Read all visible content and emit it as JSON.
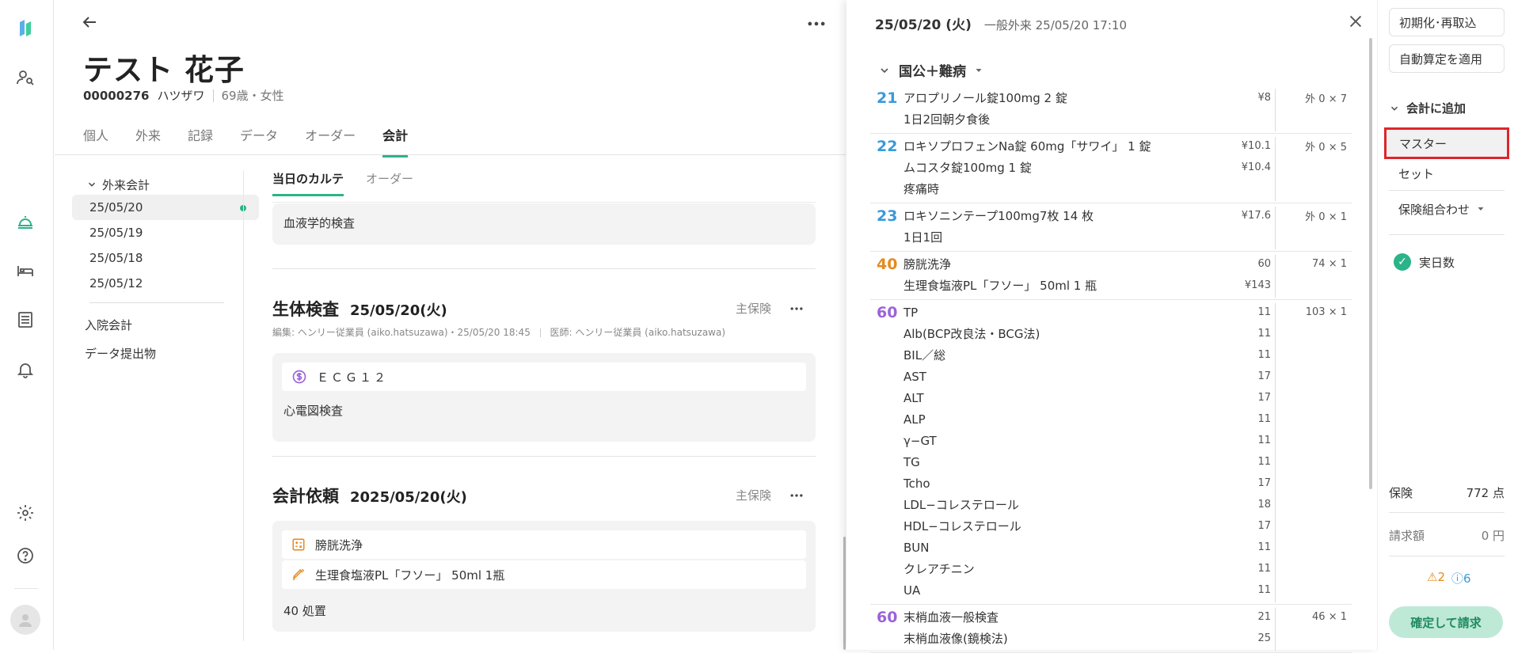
{
  "patient": {
    "name": "テスト 花子",
    "id": "00000276",
    "kana": "ハツザワ",
    "age_sex": "69歳・女性"
  },
  "tabs": [
    "個人",
    "外来",
    "記録",
    "データ",
    "オーダー",
    "会計"
  ],
  "nav": {
    "header": "外来会計",
    "dates": [
      "25/05/20",
      "25/05/19",
      "25/05/18",
      "25/05/12"
    ],
    "links": [
      "入院会計",
      "データ提出物"
    ]
  },
  "content": {
    "tabs": [
      "当日のカルテ",
      "オーダー"
    ],
    "top_card_text": "血液学的検査",
    "section1": {
      "title": "生体検査",
      "date": "25/05/20(火)",
      "meta": "編集: ヘンリー従業員 (aiko.hatsuzawa)・25/05/20 18:45",
      "meta2": "医師: ヘンリー従業員 (aiko.hatsuzawa)",
      "insurance": "主保険",
      "item": "ＥＣＧ１２",
      "note": "心電図検査"
    },
    "section2": {
      "title": "会計依頼",
      "date": "2025/05/20(火)",
      "insurance": "主保険",
      "items": [
        "膀胱洗浄",
        "生理食塩液PL「フソー」 50ml  1瓶"
      ],
      "note": "40 処置"
    }
  },
  "panel": {
    "date": "25/05/20 (火)",
    "visit": "一般外来 25/05/20 17:10",
    "group": "国公＋難病",
    "orders": [
      {
        "no": "21",
        "color": "#3a9ad9",
        "lines": [
          {
            "name": "アロプリノール錠100mg  2 錠",
            "price": "¥8",
            "qty": "外 0 × 7"
          },
          {
            "name": "1日2回朝夕食後",
            "price": "",
            "qty": ""
          }
        ]
      },
      {
        "no": "22",
        "color": "#3a9ad9",
        "lines": [
          {
            "name": "ロキソプロフェンNa錠 60mg「サワイ」  1 錠",
            "price": "¥10.1",
            "qty": "外 0 × 5"
          },
          {
            "name": "ムコスタ錠100mg  1 錠",
            "price": "¥10.4",
            "qty": ""
          },
          {
            "name": "疼痛時",
            "price": "",
            "qty": ""
          }
        ]
      },
      {
        "no": "23",
        "color": "#3a9ad9",
        "lines": [
          {
            "name": "ロキソニンテープ100mg7枚  14 枚",
            "price": "¥17.6",
            "qty": "外 0 × 1"
          },
          {
            "name": "1日1回",
            "price": "",
            "qty": ""
          }
        ]
      },
      {
        "no": "40",
        "color": "#e58a1f",
        "lines": [
          {
            "name": "膀胱洗浄",
            "price": "60",
            "qty": "74 × 1"
          },
          {
            "name": "生理食塩液PL「フソー」 50ml  1 瓶",
            "price": "¥143",
            "qty": ""
          }
        ]
      },
      {
        "no": "60",
        "color": "#9b63d9",
        "lines": [
          {
            "name": "TP",
            "price": "11",
            "qty": "103 × 1"
          },
          {
            "name": "Alb(BCP改良法・BCG法)",
            "price": "11",
            "qty": ""
          },
          {
            "name": "BIL／総",
            "price": "11",
            "qty": ""
          },
          {
            "name": "AST",
            "price": "17",
            "qty": ""
          },
          {
            "name": "ALT",
            "price": "17",
            "qty": ""
          },
          {
            "name": "ALP",
            "price": "11",
            "qty": ""
          },
          {
            "name": "γ−GT",
            "price": "11",
            "qty": ""
          },
          {
            "name": "TG",
            "price": "11",
            "qty": ""
          },
          {
            "name": "Tcho",
            "price": "17",
            "qty": ""
          },
          {
            "name": "LDL−コレステロール",
            "price": "18",
            "qty": ""
          },
          {
            "name": "HDL−コレステロール",
            "price": "17",
            "qty": ""
          },
          {
            "name": "BUN",
            "price": "11",
            "qty": ""
          },
          {
            "name": "クレアチニン",
            "price": "11",
            "qty": ""
          },
          {
            "name": "UA",
            "price": "11",
            "qty": ""
          }
        ]
      },
      {
        "no": "60",
        "color": "#9b63d9",
        "lines": [
          {
            "name": "末梢血液一般検査",
            "price": "21",
            "qty": "46 × 1"
          },
          {
            "name": "末梢血液像(鏡検法)",
            "price": "25",
            "qty": ""
          }
        ]
      }
    ]
  },
  "side": {
    "reset_btn": "初期化･再取込",
    "auto_btn": "自動算定を適用",
    "add_head": "会計に追加",
    "master": "マスター",
    "set": "セット",
    "insurance_combo": "保険組合わせ",
    "actual_days": "実日数",
    "insurance_label": "保険",
    "insurance_value": "772 点",
    "billing_label": "請求額",
    "billing_value": "0 円",
    "warn_count": "2",
    "info_count": "6",
    "confirm": "確定して請求"
  }
}
